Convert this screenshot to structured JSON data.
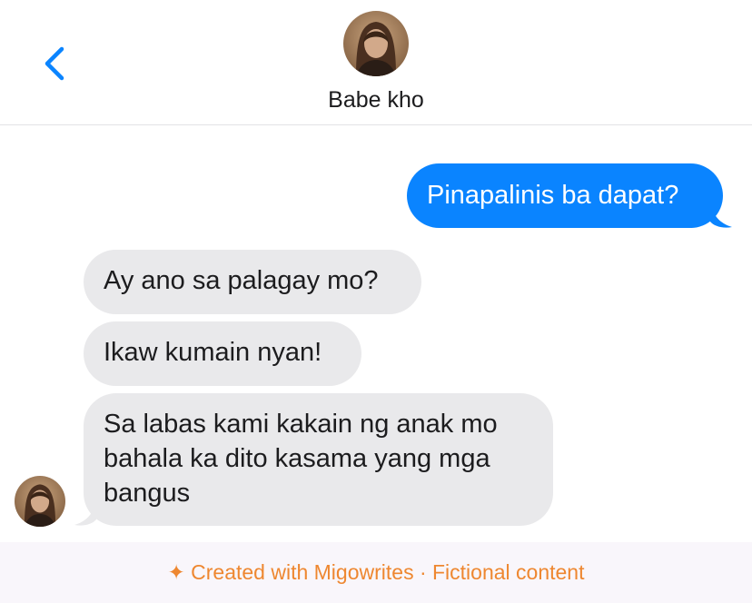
{
  "header": {
    "back_icon": "chevron-left-icon",
    "contact_name": "Babe kho"
  },
  "messages": [
    {
      "direction": "outgoing",
      "text": "Pinapalinis ba dapat?"
    },
    {
      "direction": "incoming",
      "text": "Ay ano sa palagay mo?"
    },
    {
      "direction": "incoming",
      "text": "Ikaw kumain nyan!"
    },
    {
      "direction": "incoming",
      "text": "Sa labas kami kakain ng anak mo bahala ka dito kasama yang mga bangus"
    }
  ],
  "footer": {
    "text": "✦ Created with Migowrites · Fictional content"
  },
  "colors": {
    "accent": "#0a84ff",
    "incoming_bubble": "#e9e9eb",
    "footer_text": "#ee8730"
  }
}
